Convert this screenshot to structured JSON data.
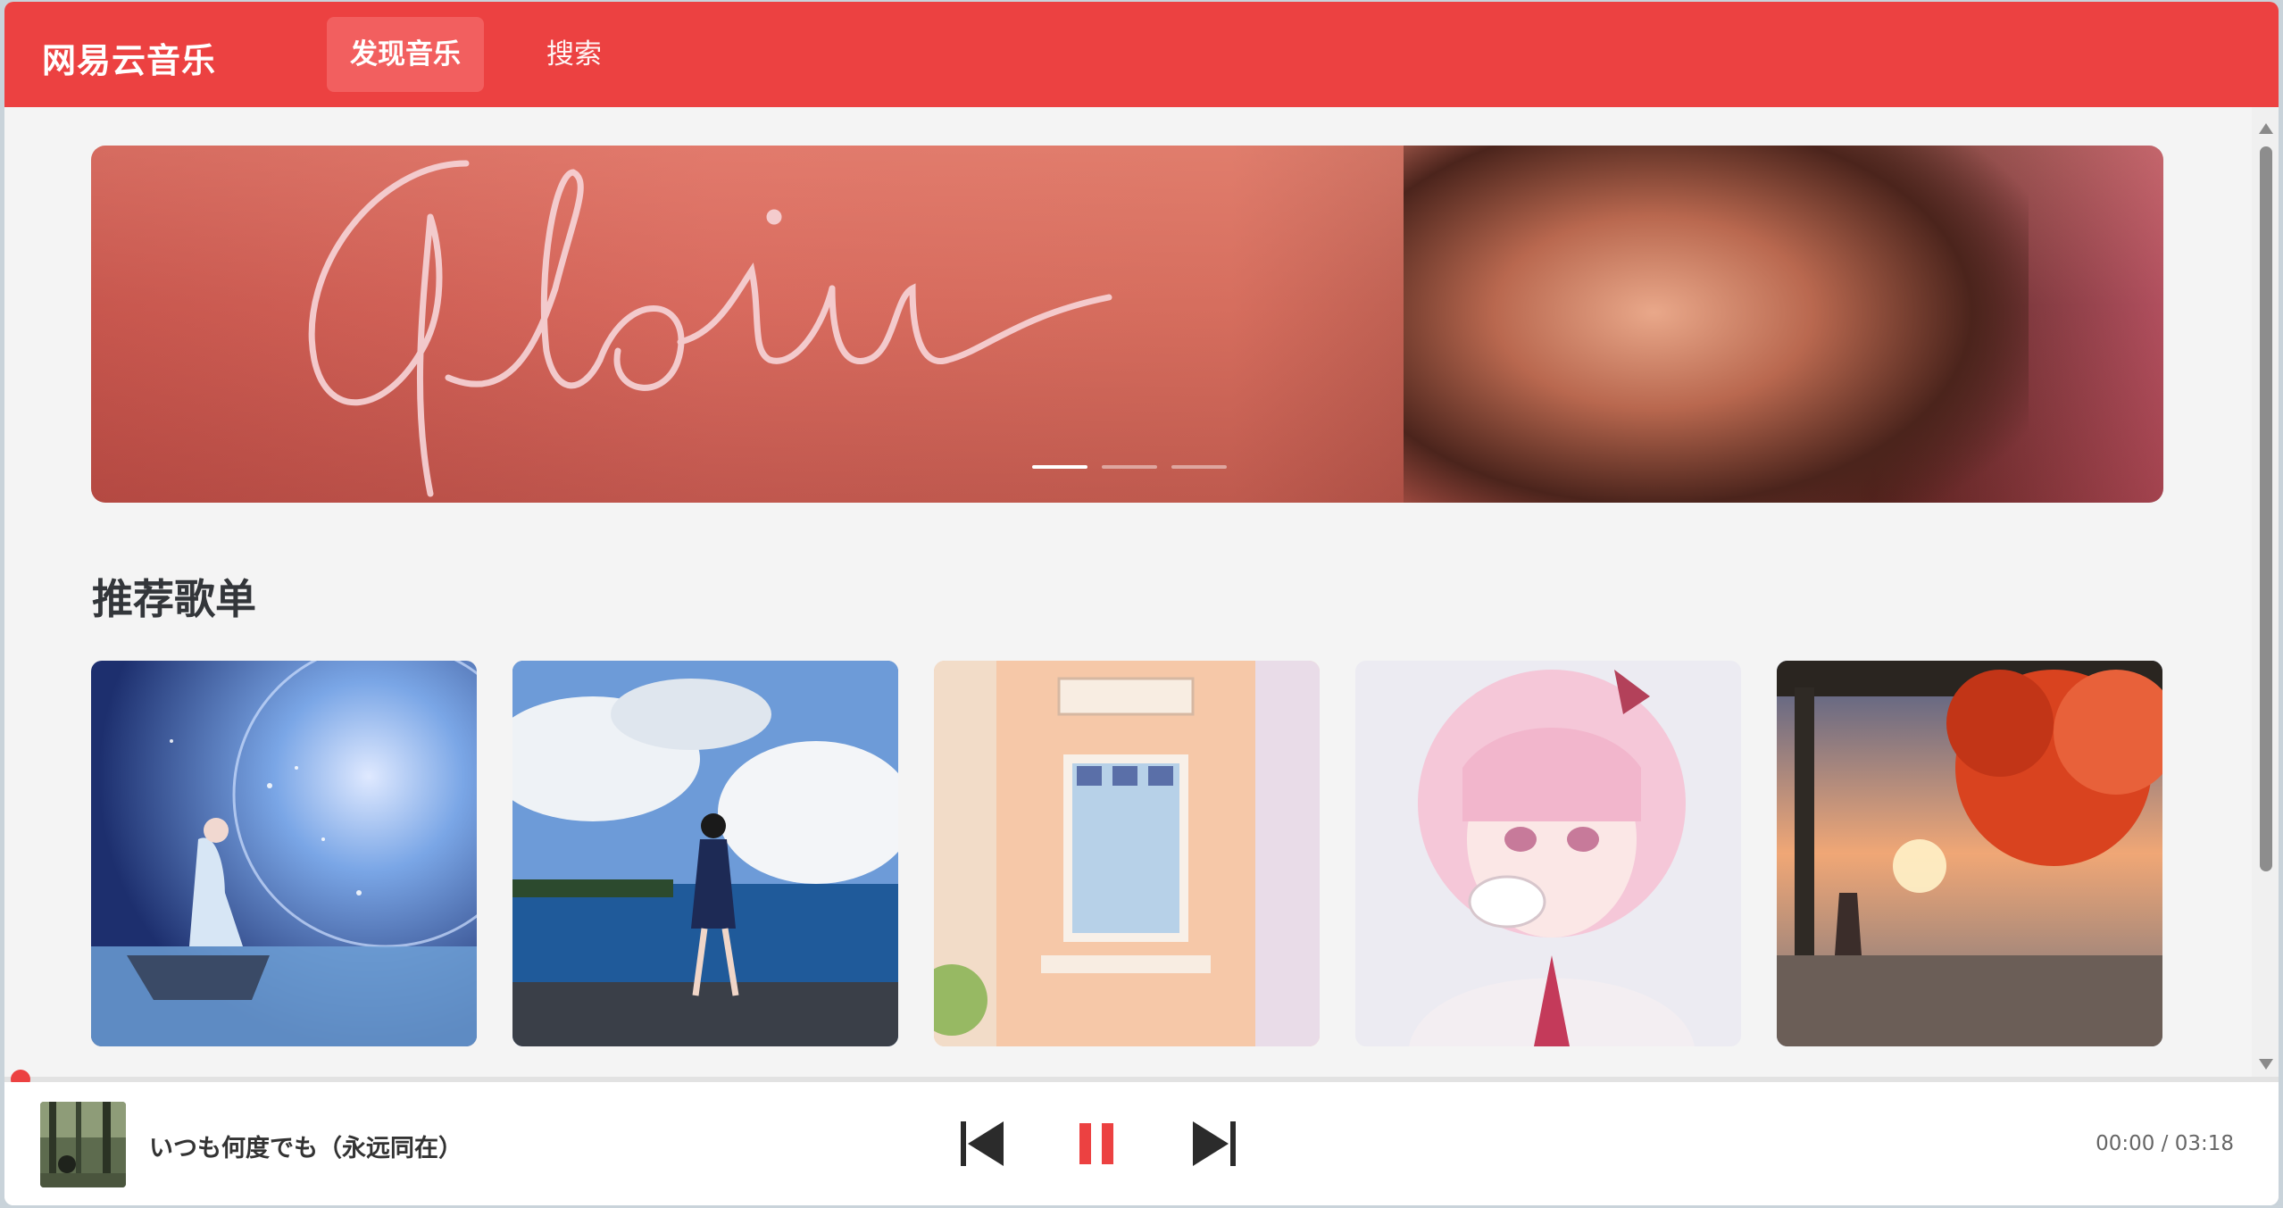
{
  "app": {
    "title": "网易云音乐"
  },
  "nav": {
    "tabs": [
      {
        "label": "发现音乐",
        "active": true
      },
      {
        "label": "搜索",
        "active": false
      }
    ]
  },
  "banner": {
    "script_text": "Gloria",
    "dot_count": 3,
    "active_dot": 0
  },
  "section": {
    "title": "推荐歌单"
  },
  "playlists": [
    {
      "art": "moon-boat-girl"
    },
    {
      "art": "seaside-clouds-girl"
    },
    {
      "art": "pastel-building-window"
    },
    {
      "art": "pink-hair-girl-tea"
    },
    {
      "art": "autumn-tree-sunset"
    }
  ],
  "player": {
    "song_title": "いつも何度でも（永远同在）",
    "time": "00:00 / 03:18",
    "progress": 0,
    "state": "playing"
  },
  "colors": {
    "accent": "#ec4141",
    "accent_light": "#f25f5f",
    "text_dark": "#33363a"
  }
}
